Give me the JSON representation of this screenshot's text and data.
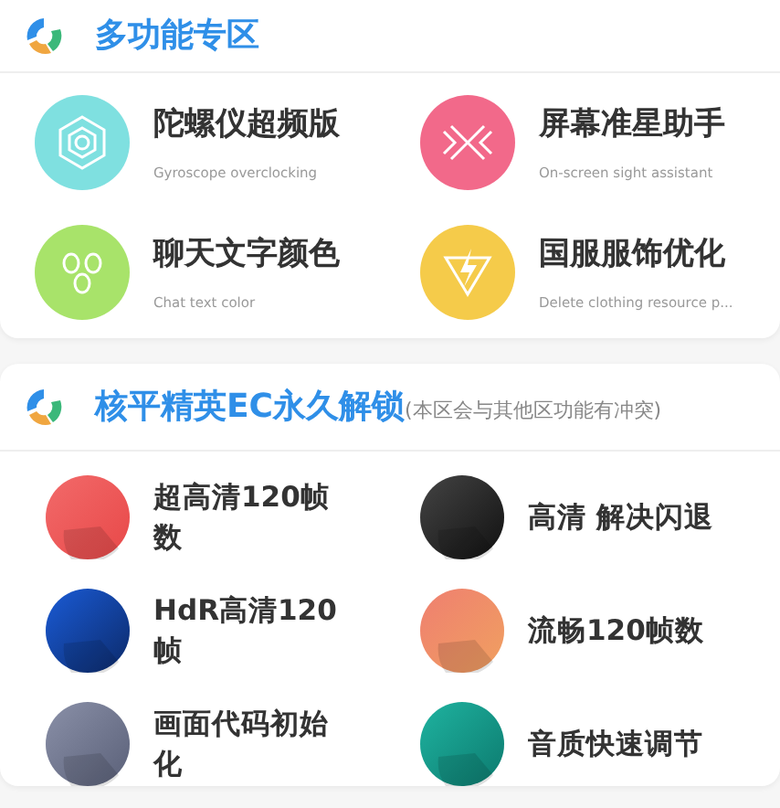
{
  "sections": [
    {
      "title": "多功能专区",
      "items": [
        {
          "title": "陀螺仪超频版",
          "subtitle": "Gyroscope overclocking"
        },
        {
          "title": "屏幕准星助手",
          "subtitle": "On-screen sight assistant"
        },
        {
          "title": "聊天文字颜色",
          "subtitle": "Chat text color"
        },
        {
          "title": "国服服饰优化",
          "subtitle": "Delete clothing resource p..."
        }
      ]
    },
    {
      "title": "核平精英EC永久解锁",
      "note": "(本区会与其他区功能有冲突)",
      "items": [
        {
          "title": "超高清120帧数"
        },
        {
          "title": "高清 解决闪退"
        },
        {
          "title": "HdR高清120帧"
        },
        {
          "title": "流畅120帧数"
        },
        {
          "title": "画面代码初始化"
        },
        {
          "title": "音质快速调节"
        }
      ]
    }
  ]
}
